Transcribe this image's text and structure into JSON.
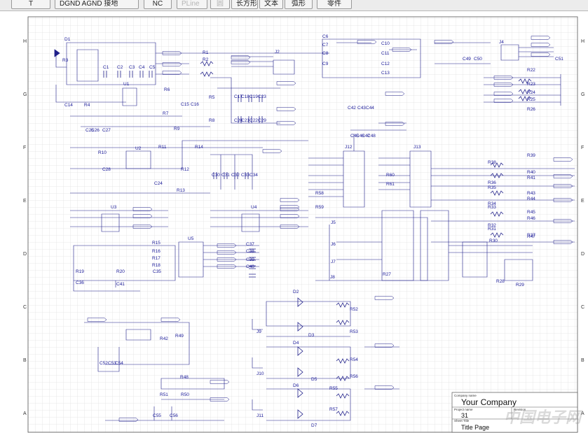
{
  "toolbar": {
    "buttons": [
      {
        "label": "T",
        "enabled": true
      },
      {
        "label": "DGND AGND 接地",
        "enabled": true
      },
      {
        "label": "NC",
        "enabled": true
      },
      {
        "label": "PLine",
        "enabled": false
      },
      {
        "label": "圆",
        "enabled": false
      },
      {
        "label": "长方形",
        "enabled": true
      },
      {
        "label": "文本",
        "enabled": true
      },
      {
        "label": "弧形",
        "enabled": true
      },
      {
        "label": "零件",
        "enabled": true
      }
    ]
  },
  "grid": {
    "rows": [
      "H",
      "G",
      "F",
      "E",
      "D",
      "C",
      "B",
      "A"
    ]
  },
  "title_block": {
    "company_caption": "Company name",
    "company": "Your Company",
    "project_caption": "Project name",
    "project": "31",
    "revision_caption": "Revision",
    "sheet_caption": "Sheet Title",
    "sheet_title": "Title Page"
  },
  "watermark": "中国电子网",
  "components": {
    "ics": [
      "U1",
      "U2",
      "U3",
      "U4",
      "U5",
      "J2",
      "J4",
      "J8",
      "J9",
      "J10",
      "J11",
      "J12",
      "J13",
      "J5",
      "J6",
      "J7"
    ],
    "resistors": [
      "R1",
      "R2",
      "R3",
      "R4",
      "R5",
      "R6",
      "R7",
      "R8",
      "R9",
      "R10",
      "R11",
      "R12",
      "R13",
      "R14",
      "R15",
      "R16",
      "R17",
      "R18",
      "R19",
      "R20",
      "R22",
      "R23",
      "R24",
      "R25",
      "R26",
      "R27",
      "R28",
      "R29",
      "R30",
      "R31",
      "R32",
      "R33",
      "R34",
      "R35",
      "R36",
      "R37",
      "R38",
      "R39",
      "R40",
      "R41",
      "R42",
      "R43",
      "R44",
      "R45",
      "R46",
      "R47",
      "R48",
      "R49",
      "R50",
      "R51",
      "R52",
      "R53",
      "R54",
      "R55",
      "R56",
      "R57",
      "R58",
      "R59",
      "R60",
      "R61"
    ],
    "capacitors": [
      "C1",
      "C2",
      "C3",
      "C4",
      "C5",
      "C6",
      "C7",
      "C8",
      "C9",
      "C10",
      "C11",
      "C12",
      "C13",
      "C14",
      "C15",
      "C16",
      "C17",
      "C18",
      "C19",
      "C20",
      "C21",
      "C22",
      "C23",
      "C24",
      "C25",
      "C26",
      "C27",
      "C28",
      "C29",
      "C30",
      "C31",
      "C32",
      "C33",
      "C34",
      "C35",
      "C36",
      "C37",
      "C38",
      "C39",
      "C40",
      "C41",
      "C42",
      "C43",
      "C44",
      "C45",
      "C46",
      "C47",
      "C48",
      "C49",
      "C50",
      "C51",
      "C52",
      "C53",
      "C54",
      "C55",
      "C56"
    ],
    "diodes": [
      "D1",
      "D2",
      "D3",
      "D4",
      "D5",
      "D6",
      "D7"
    ]
  }
}
